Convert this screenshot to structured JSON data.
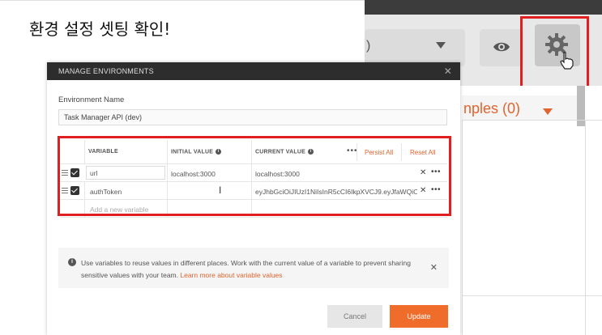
{
  "caption": "환경 설정 셋팅 확인!",
  "background": {
    "env_select_partial": ")",
    "examples_label": "nples (0)"
  },
  "modal": {
    "title": "MANAGE ENVIRONMENTS",
    "close": "✕",
    "env_name_label": "Environment Name",
    "env_name_value": "Task Manager API (dev)",
    "table": {
      "headers": {
        "variable": "VARIABLE",
        "initial_value": "INITIAL VALUE",
        "current_value": "CURRENT VALUE",
        "more": "•••",
        "persist_all": "Persist All",
        "reset_all": "Reset All"
      },
      "rows": [
        {
          "variable": "url",
          "initial_value": "localhost:3000",
          "current_value": "localhost:3000",
          "checked": true
        },
        {
          "variable": "authToken",
          "initial_value": "",
          "current_value": "eyJhbGciOiJIUzI1NiIsInR5cCI6IkpXVCJ9.eyJfaWQiOiI1",
          "checked": true
        }
      ],
      "new_row_placeholder": "Add a new variable",
      "row_remove": "✕",
      "row_more": "•••"
    },
    "notice": {
      "text": "Use variables to reuse values in different places. Work with the current value of a variable to prevent sharing sensitive values with your team.",
      "link": "Learn more about variable values",
      "close": "✕"
    },
    "buttons": {
      "cancel": "Cancel",
      "update": "Update"
    }
  },
  "colors": {
    "accent": "#ef6c2b",
    "highlight": "#e02020",
    "header_bg": "#2d2d2d"
  }
}
